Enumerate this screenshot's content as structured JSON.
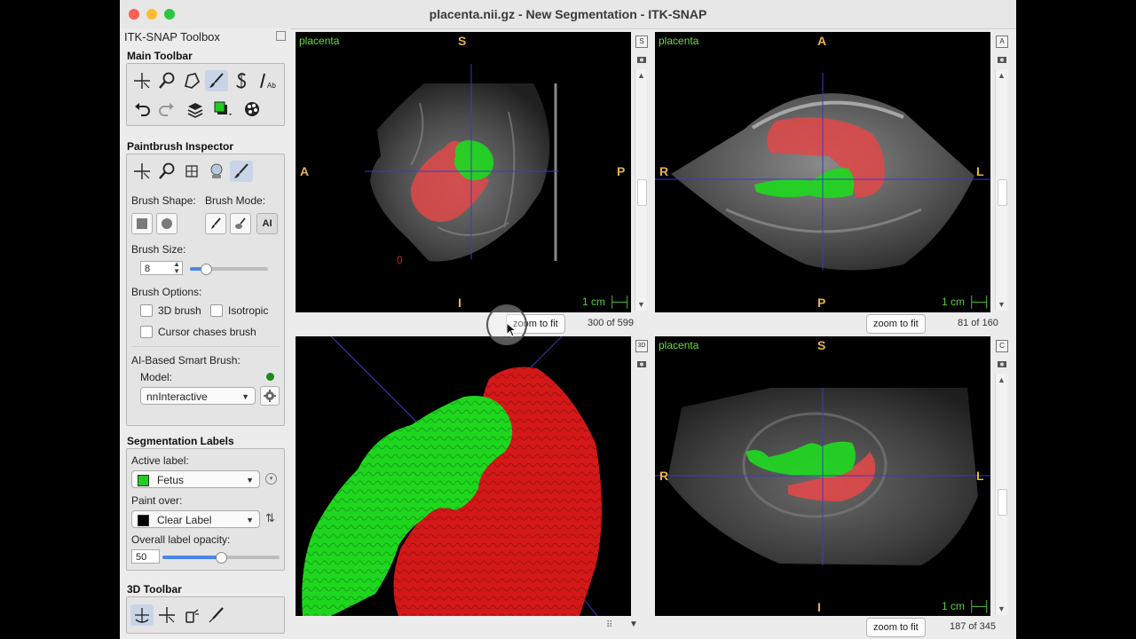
{
  "window": {
    "title": "placenta.nii.gz - New Segmentation - ITK-SNAP"
  },
  "sidebar": {
    "title": "ITK-SNAP Toolbox",
    "main_toolbar": {
      "heading": "Main Toolbar",
      "tools": [
        "crosshair-tool",
        "zoom-tool",
        "polygon-tool",
        "paintbrush-tool",
        "snake-tool",
        "annotation-tool"
      ],
      "actions": [
        "undo",
        "redo",
        "layers",
        "label-color",
        "palette"
      ]
    },
    "paintbrush": {
      "heading": "Paintbrush Inspector",
      "brush_shape_label": "Brush Shape:",
      "brush_mode_label": "Brush Mode:",
      "ai_label": "AI",
      "brush_size_label": "Brush Size:",
      "brush_size_value": "8",
      "brush_size_fraction": 0.2,
      "brush_options_label": "Brush Options:",
      "opt_3d": "3D brush",
      "opt_iso": "Isotropic",
      "opt_chase": "Cursor chases brush",
      "ai_section_label": "AI-Based Smart Brush:",
      "model_label": "Model:",
      "model_value": "nnInteractive",
      "model_status_color": "#1a8a1a"
    },
    "labels": {
      "heading": "Segmentation Labels",
      "active_label_caption": "Active label:",
      "active_label": "Fetus",
      "active_color": "#22cc22",
      "paint_over_caption": "Paint over:",
      "paint_over": "Clear Label",
      "paint_over_color": "#000000",
      "opacity_caption": "Overall label opacity:",
      "opacity_value": "50",
      "opacity_fraction": 0.5
    },
    "toolbar3d": {
      "heading": "3D Toolbar"
    }
  },
  "views": {
    "top_left": {
      "layer": "placenta",
      "top": "S",
      "bottom": "I",
      "left": "A",
      "right": "P",
      "scale": "1 cm",
      "marker": "0",
      "zoom": "zoom to fit",
      "slice": "300 of 599"
    },
    "top_right": {
      "layer": "placenta",
      "top": "A",
      "bottom": "P",
      "left": "R",
      "right": "L",
      "scale": "1 cm",
      "zoom": "zoom to fit",
      "slice": "81 of 160"
    },
    "bottom_left": {
      "mode": "3D"
    },
    "bottom_right": {
      "layer": "placenta",
      "top": "S",
      "bottom": "I",
      "left": "R",
      "right": "L",
      "scale": "1 cm",
      "zoom": "zoom to fit",
      "slice": "187 of 345"
    }
  },
  "colors": {
    "placenta": "#e04848",
    "fetus": "#22d422",
    "crosshair": "#3a3acc",
    "orientation": "#e8b24a",
    "layer_label": "#6adf3e"
  }
}
